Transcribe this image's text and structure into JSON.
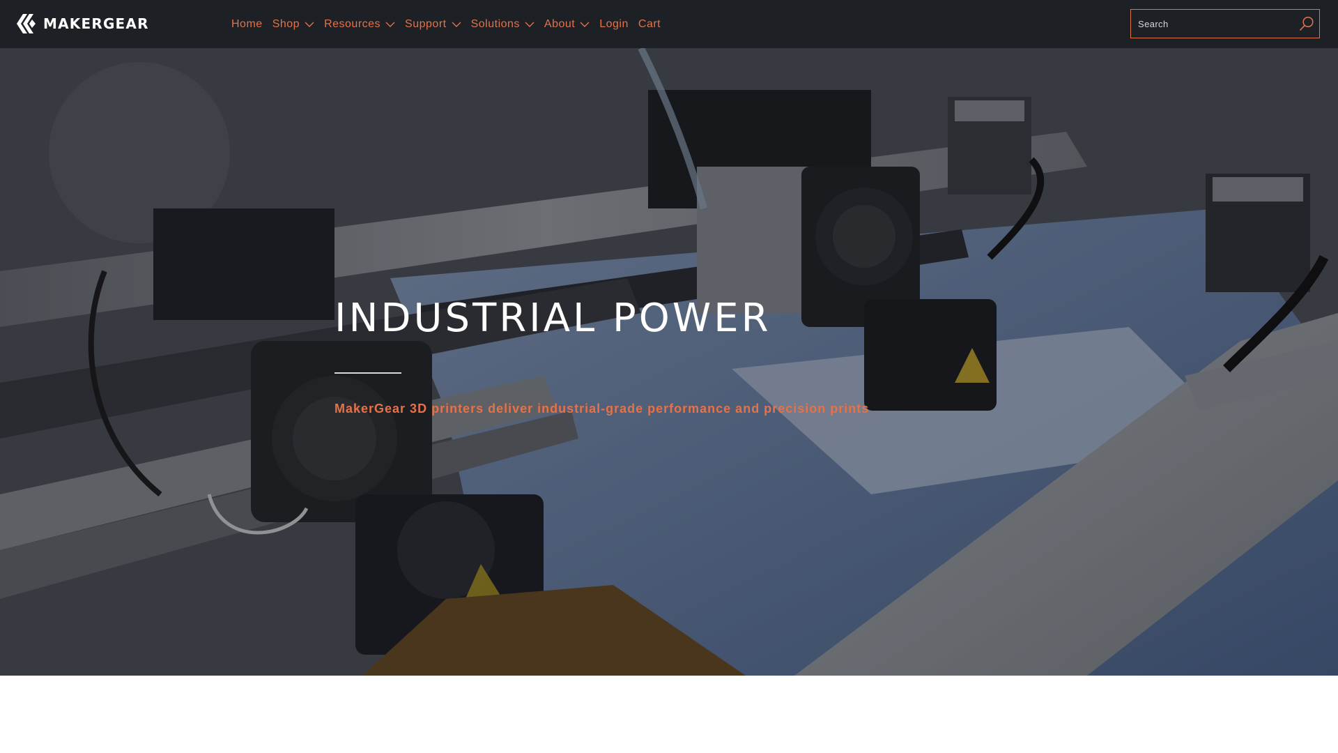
{
  "brand": {
    "name": "MAKERGEAR",
    "accent_color": "#e4724a",
    "header_bg": "#1d2025",
    "logo_icon": "makergear-logo-icon"
  },
  "nav": {
    "items": [
      {
        "label": "Home",
        "has_dropdown": false
      },
      {
        "label": "Shop",
        "has_dropdown": true
      },
      {
        "label": "Resources",
        "has_dropdown": true
      },
      {
        "label": "Support",
        "has_dropdown": true
      },
      {
        "label": "Solutions",
        "has_dropdown": true
      },
      {
        "label": "About",
        "has_dropdown": true
      },
      {
        "label": "Login",
        "has_dropdown": false
      },
      {
        "label": "Cart",
        "has_dropdown": false
      }
    ]
  },
  "search": {
    "placeholder": "Search",
    "icon": "search-icon"
  },
  "hero": {
    "title": "INDUSTRIAL POWER",
    "subtitle": "MakerGear 3D printers deliver industrial-grade performance and precision prints",
    "background": "3d-printer-extruder-photo"
  }
}
